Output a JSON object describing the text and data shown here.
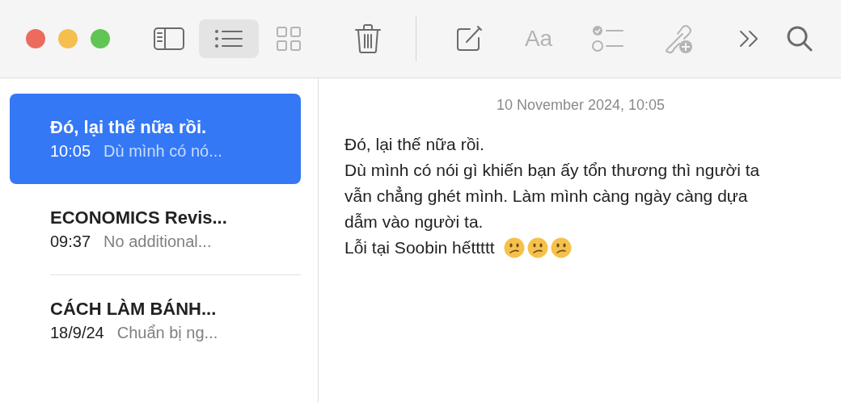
{
  "window": {
    "controls": [
      {
        "color": "#ed6a5e"
      },
      {
        "color": "#f5bf4f"
      },
      {
        "color": "#61c554"
      }
    ]
  },
  "toolbar": [
    {
      "kind": "sidebar",
      "selected": false,
      "disabled": false
    },
    {
      "kind": "list",
      "selected": true,
      "disabled": false
    },
    {
      "kind": "gallery",
      "selected": false,
      "disabled": true
    },
    {
      "kind": "trash",
      "selected": false,
      "disabled": false
    },
    {
      "kind": "divider"
    },
    {
      "kind": "compose",
      "selected": false,
      "disabled": false
    },
    {
      "kind": "format",
      "label": "Aa",
      "selected": false,
      "disabled": true
    },
    {
      "kind": "checklist",
      "selected": false,
      "disabled": true
    },
    {
      "kind": "link",
      "selected": false,
      "disabled": true
    },
    {
      "kind": "more",
      "selected": false,
      "disabled": false
    },
    {
      "kind": "search",
      "selected": false,
      "disabled": false
    }
  ],
  "notes": [
    {
      "title": "Đó, lại thế nữa rồi.",
      "time": "10:05",
      "preview": "Dù mình có nó...",
      "selected": true
    },
    {
      "title": "ECONOMICS Revis...",
      "time": "09:37",
      "preview": "No additional...",
      "selected": false
    },
    {
      "title": "CÁCH LÀM BÁNH...",
      "time": "18/9/24",
      "preview": "Chuẩn bị ng...",
      "selected": false
    }
  ],
  "editor": {
    "date": "10 November 2024, 10:05",
    "paragraphs": [
      {
        "text": "Đó, lại thế nữa rồi."
      },
      {
        "text": "Dù mình có nói gì khiến bạn ấy tổn thương thì người ta vẫn chẳng ghét mình. Làm mình càng ngày càng dựa dẫm vào người ta."
      },
      {
        "text": "Lỗi tại Soobin hếttttt",
        "emojis": [
          {
            "kind": "confused"
          },
          {
            "kind": "confused"
          },
          {
            "kind": "confused"
          }
        ]
      }
    ]
  }
}
